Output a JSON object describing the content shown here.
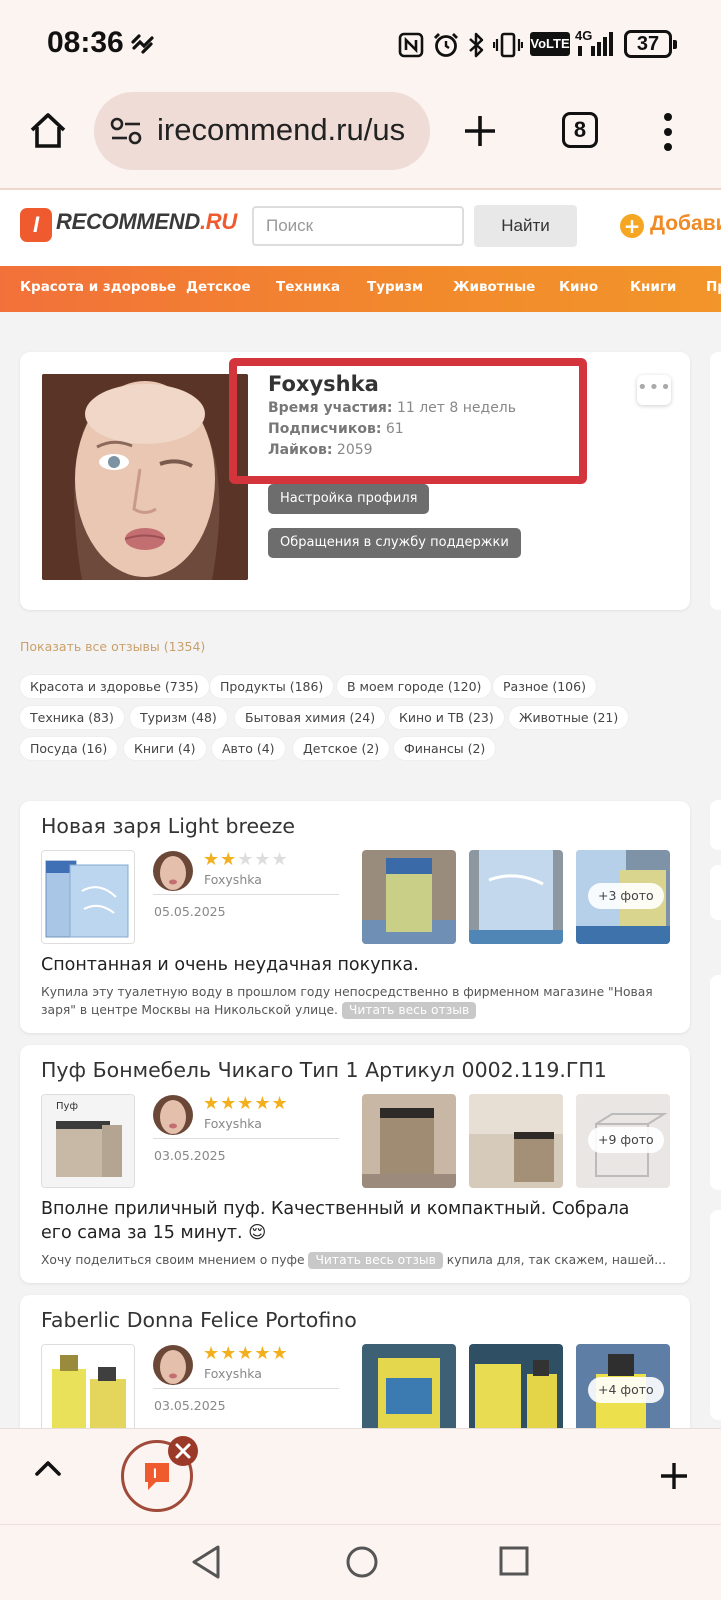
{
  "status_bar": {
    "time": "08:36",
    "network": "VoLTE",
    "signal": "4G",
    "battery": "37"
  },
  "browser": {
    "url": "irecommend.ru/us",
    "tab_count": "8"
  },
  "site": {
    "logo_main": "RECOMMEND",
    "logo_ru": ".RU",
    "logo_badge": "I",
    "search_placeholder": "Поиск",
    "search_button": "Найти",
    "add_label": "Добави"
  },
  "categories": [
    "Красота и здоровье",
    "Детское",
    "Техника",
    "Туризм",
    "Животные",
    "Кино",
    "Книги",
    "Пр"
  ],
  "profile": {
    "name": "Foxyshka",
    "membership_label": "Время участия:",
    "membership_value": "11 лет 8 недель",
    "subscribers_label": "Подписчиков:",
    "subscribers_value": "61",
    "likes_label": "Лайков:",
    "likes_value": "2059",
    "settings_button": "Настройка профиля",
    "support_button": "Обращения в службу поддержки",
    "more_button": "•••"
  },
  "show_all_reviews": "Показать все отзывы (1354)",
  "tags": [
    "Красота и здоровье (735)",
    "Продукты (186)",
    "В моем городе (120)",
    "Разное (106)",
    "Техника (83)",
    "Туризм (48)",
    "Бытовая химия (24)",
    "Кино и ТВ (23)",
    "Животные (21)",
    "Посуда (16)",
    "Книги (4)",
    "Авто (4)",
    "Детское (2)",
    "Финансы (2)"
  ],
  "reviews": [
    {
      "title": "Новая заря Light breeze",
      "author": "Foxyshka",
      "rating": 2,
      "date": "05.05.2025",
      "more_photos": "+3 фото",
      "headline": "Спонтанная и очень неудачная покупка.",
      "snippet_before": "Купила эту туалетную воду в прошлом году непосредственно в фирменном магазине \"Новая заря\" в центре Москвы на Никольской улице.",
      "snippet_after": "",
      "read_more": "Читать весь отзыв",
      "colors": {
        "accent": "#8ab0d8"
      }
    },
    {
      "title": "Пуф Бонмебель Чикаго Тип 1 Артикул 0002.119.ГП1",
      "author": "Foxyshka",
      "rating": 5,
      "date": "03.05.2025",
      "more_photos": "+9 фото",
      "headline": "Вполне приличный пуф. Качественный и компактный. Собрала его сама за 15 минут. 😌",
      "snippet_before": "Хочу поделиться своим мнением о пуфе",
      "snippet_after": "купила для, так скажем, нашей...",
      "read_more": "Читать весь отзыв",
      "product_label": "Пуф"
    },
    {
      "title": "Faberlic Donna Felice Portofino",
      "author": "Foxyshka",
      "rating": 5,
      "date": "03.05.2025",
      "more_photos": "+4 фото"
    }
  ],
  "colors": {
    "brand": "#ef5b2f",
    "highlight_box": "#d4343c",
    "star": "#f2b01e"
  }
}
